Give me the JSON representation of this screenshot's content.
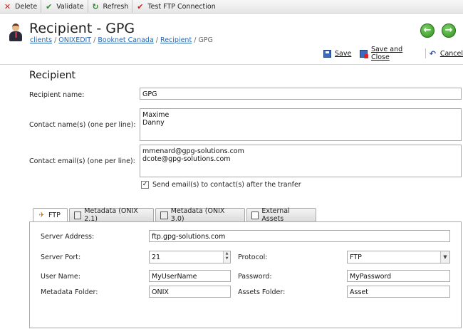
{
  "toolbar": {
    "delete_label": "Delete",
    "validate_label": "Validate",
    "refresh_label": "Refresh",
    "test_label": "Test FTP Connection"
  },
  "header": {
    "title": "Recipient - GPG",
    "breadcrumb": [
      "clients",
      "ONIXEDIT",
      "Booknet Canada",
      "Recipient",
      "GPG"
    ],
    "back_symbol": "←",
    "forward_symbol": "→"
  },
  "actions": {
    "save_label": "Save",
    "save_close_label": "Save and Close",
    "cancel_label": "Cancel"
  },
  "form": {
    "section_title": "Recipient",
    "recipient_name_label": "Recipient name:",
    "recipient_name_value": "GPG",
    "contact_names_label": "Contact name(s) (one per line):",
    "contact_names_value": "Maxime\nDanny",
    "contact_emails_label": "Contact email(s) (one per line):",
    "contact_emails_value": "mmenard@gpg-solutions.com\ndcote@gpg-solutions.com",
    "send_email_checked": true,
    "send_email_label": "Send email(s) to contact(s) after the tranfer"
  },
  "tabs": [
    {
      "label": "FTP",
      "icon": "ftp-icon",
      "active": true
    },
    {
      "label": "Metadata (ONIX 2.1)",
      "icon": "metadata-icon",
      "active": false
    },
    {
      "label": "Metadata (ONIX 3.0)",
      "icon": "metadata-icon",
      "active": false
    },
    {
      "label": "External Assets",
      "icon": "external-assets-icon",
      "active": false
    }
  ],
  "ftp": {
    "server_address_label": "Server Address:",
    "server_address_value": "ftp.gpg-solutions.com",
    "server_port_label": "Server Port:",
    "server_port_value": "21",
    "protocol_label": "Protocol:",
    "protocol_value": "FTP",
    "user_name_label": "User Name:",
    "user_name_value": "MyUserName",
    "password_label": "Password:",
    "password_value": "MyPassword",
    "metadata_folder_label": "Metadata Folder:",
    "metadata_folder_value": "ONIX",
    "assets_folder_label": "Assets Folder:",
    "assets_folder_value": "Asset"
  },
  "colors": {
    "link": "#2a66b0",
    "delete": "#cc1f1f",
    "validate": "#2b8a2b",
    "nav_green": "#2f8f1e"
  }
}
